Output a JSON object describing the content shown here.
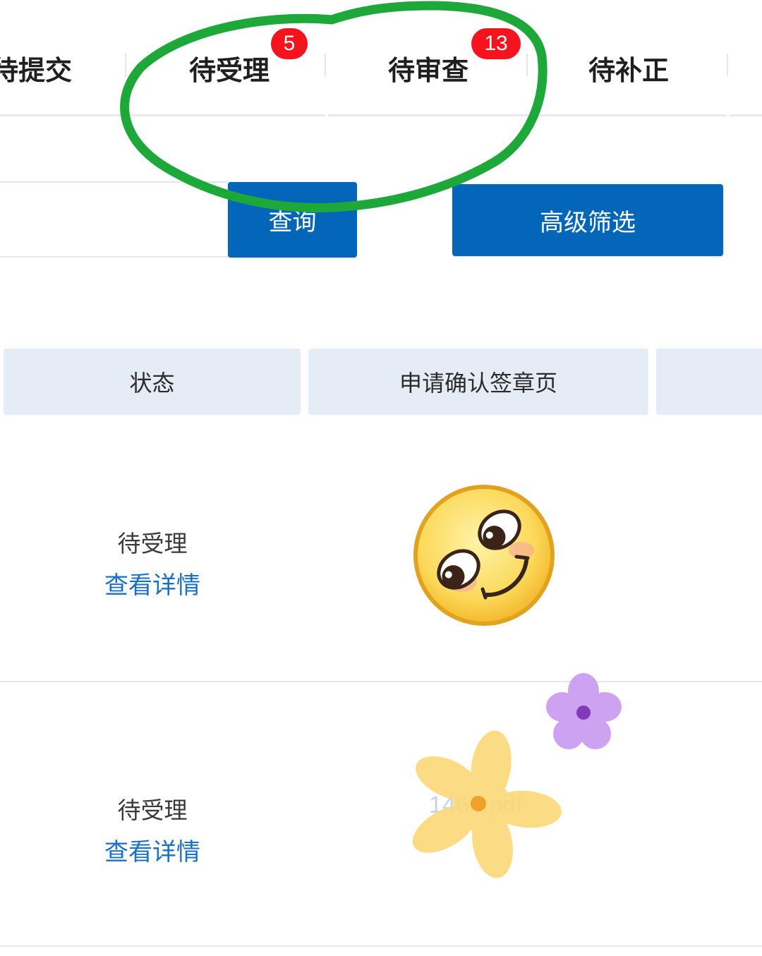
{
  "tabs": [
    {
      "label": "待提交",
      "visible_label": "待提交",
      "badge": null
    },
    {
      "label": "待受理",
      "badge": "5"
    },
    {
      "label": "待审查",
      "badge": "13"
    },
    {
      "label": "待补正",
      "badge": null
    }
  ],
  "search": {
    "query_button": "查询",
    "advanced_filter_button": "高级筛选"
  },
  "table": {
    "columns": [
      "状态",
      "申请确认签章页",
      ""
    ],
    "rows": [
      {
        "status": "待受理",
        "action": "查看详情",
        "file": ""
      },
      {
        "status": "待受理",
        "action": "查看详情",
        "file": "1460.pdf"
      }
    ]
  },
  "decor": {
    "highlight_color": "#1ea83a",
    "accent_color": "#0366b8",
    "badge_color": "#f5131d",
    "stickers": [
      "smiling-emoji-icon",
      "yellow-flower-icon",
      "purple-flower-icon"
    ]
  }
}
